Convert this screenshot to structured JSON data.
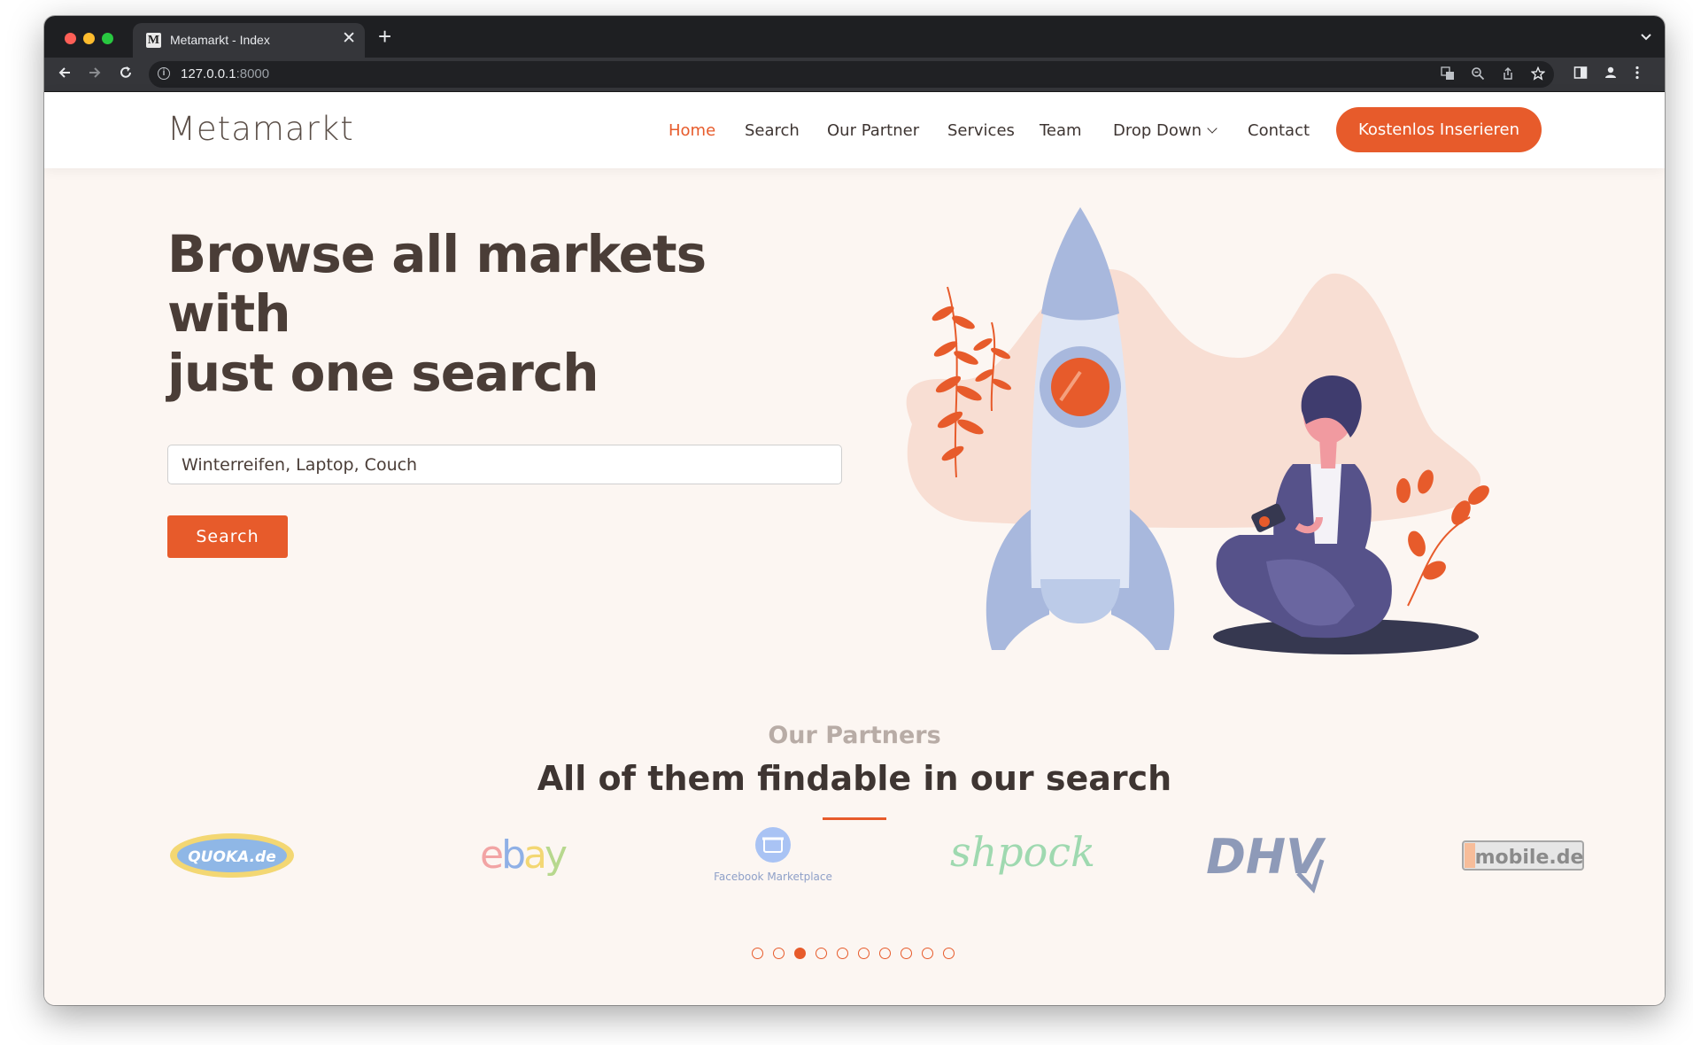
{
  "browser": {
    "tab_title": "Metamarkt - Index",
    "tab_favicon": "M",
    "url_host": "127.0.0.1",
    "url_port": ":8000"
  },
  "header": {
    "brand": "Metamarkt",
    "nav": [
      {
        "label": "Home",
        "active": true
      },
      {
        "label": "Search"
      },
      {
        "label": "Our Partner"
      },
      {
        "label": "Services"
      },
      {
        "label": "Team"
      },
      {
        "label": "Drop Down",
        "dropdown": true
      },
      {
        "label": "Contact"
      }
    ],
    "cta": "Kostenlos Inserieren"
  },
  "hero": {
    "title_line1": "Browse all markets with",
    "title_line2": "just one search",
    "search_placeholder": "Winterreifen, Laptop, Couch",
    "search_button": "Search"
  },
  "partners": {
    "kicker": "Our Partners",
    "title": "All of them findable in our search",
    "logos": [
      {
        "name": "quoka",
        "text": "QUOKA.de"
      },
      {
        "name": "ebay",
        "text": "ebay"
      },
      {
        "name": "facebook-marketplace",
        "text": "Facebook Marketplace"
      },
      {
        "name": "shpock",
        "text": "shpock"
      },
      {
        "name": "dhv",
        "text": "DHV"
      },
      {
        "name": "mobile-de",
        "text": "mobile.de"
      }
    ],
    "carousel_total": 10,
    "carousel_active": 3
  },
  "colors": {
    "accent": "#e75b2b",
    "heading": "#4a3d37",
    "background": "#fcf6f2"
  }
}
